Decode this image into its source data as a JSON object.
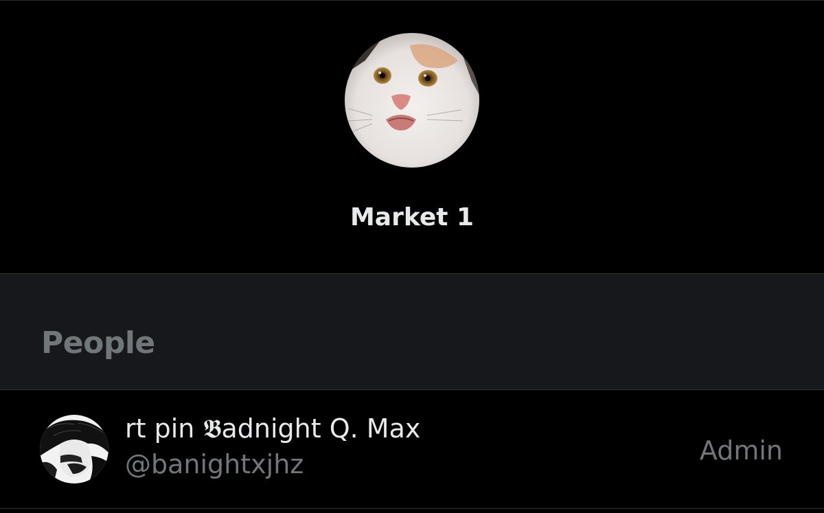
{
  "group": {
    "name": "Market 1",
    "avatar_icon": "cat-photo-avatar"
  },
  "people_section": {
    "title": "People"
  },
  "members": [
    {
      "display_name": "rt pin 𝕭adnight Q. Max",
      "handle": "@banightxjhz",
      "role": "Admin",
      "avatar_icon": "user-photo-avatar"
    }
  ],
  "colors": {
    "background": "#000000",
    "section_background": "#16181c",
    "primary_text": "#e7e9ea",
    "secondary_text": "#71767b",
    "divider": "#2f3336"
  }
}
